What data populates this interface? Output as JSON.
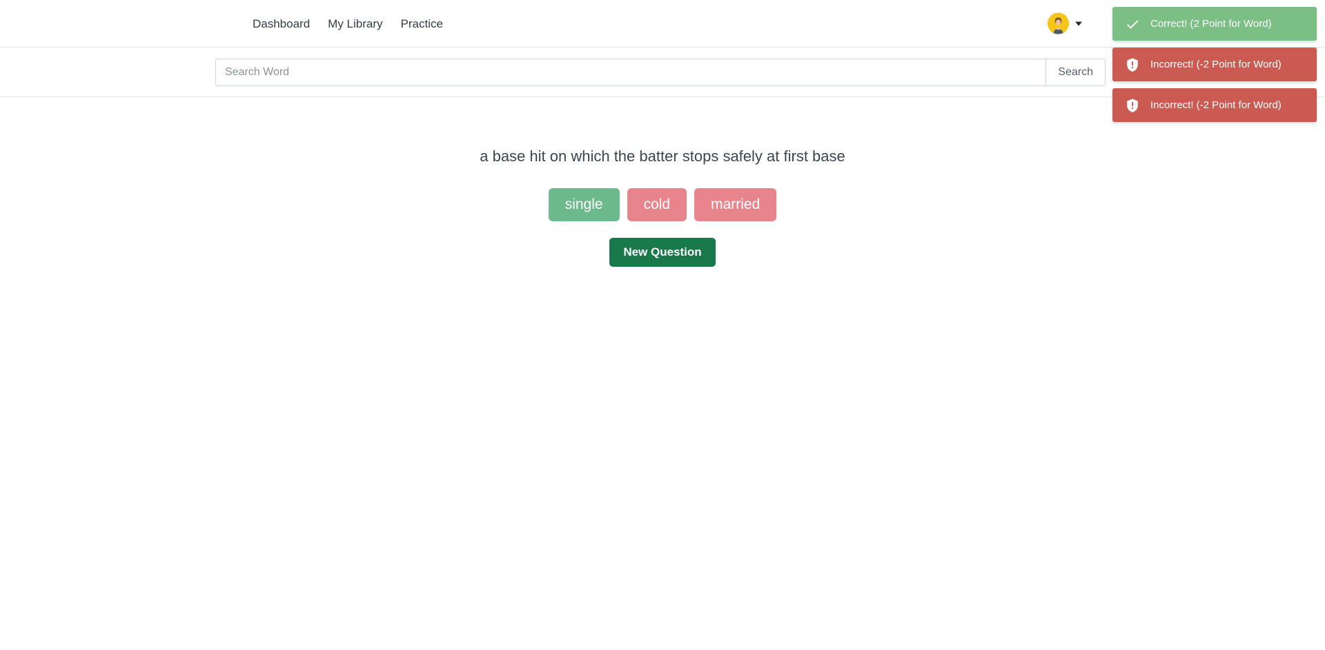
{
  "navbar": {
    "links": [
      {
        "label": "Dashboard"
      },
      {
        "label": "My Library"
      },
      {
        "label": "Practice"
      }
    ],
    "account": {
      "avatar_icon": "user-avatar-icon",
      "caret_icon": "chevron-down-icon"
    }
  },
  "search": {
    "placeholder": "Search Word",
    "value": "",
    "button_label": "Search"
  },
  "quiz": {
    "question": "a base hit on which the batter stops safely at first base",
    "choices": [
      {
        "label": "single",
        "state": "correct"
      },
      {
        "label": "cold",
        "state": "incorrect"
      },
      {
        "label": "married",
        "state": "incorrect"
      }
    ],
    "new_question_label": "New Question"
  },
  "toasts": [
    {
      "type": "success",
      "icon": "check-icon",
      "message": "Correct! (2 Point for Word)"
    },
    {
      "type": "error",
      "icon": "shield-exclamation-icon",
      "message": "Incorrect! (-2 Point for Word)"
    },
    {
      "type": "error",
      "icon": "shield-exclamation-icon",
      "message": "Incorrect! (-2 Point for Word)"
    }
  ],
  "colors": {
    "toast_success_bg": "#7cbf85",
    "toast_error_bg": "#cb5b52",
    "choice_correct_bg": "#6cba8c",
    "choice_incorrect_bg": "#e8848c",
    "new_question_bg": "#19794a",
    "avatar_bg": "#f5c518"
  }
}
